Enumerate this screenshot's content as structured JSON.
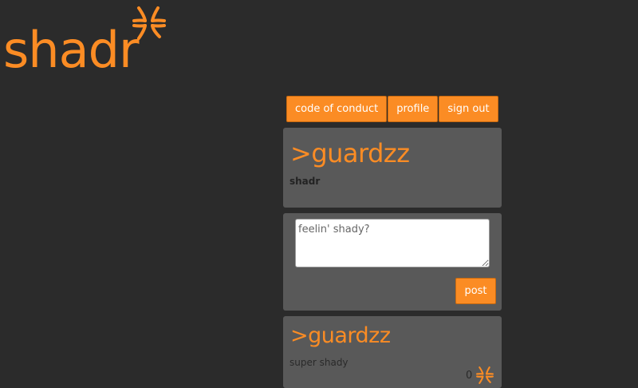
{
  "app": {
    "logo_text": "shadr",
    "brand_color": "#fb8c24",
    "logo_icon": "anger-symbol-icon"
  },
  "nav": {
    "items": [
      {
        "label": "code of conduct"
      },
      {
        "label": "profile"
      },
      {
        "label": "sign out"
      }
    ]
  },
  "profile": {
    "handle": ">guardzz",
    "subtitle": "shadr"
  },
  "compose": {
    "placeholder": "feelin' shady?",
    "value": "",
    "post_label": "post"
  },
  "feed": {
    "posts": [
      {
        "handle": ">guardzz",
        "body": "super shady",
        "shade_count": "0",
        "shade_icon": "anger-symbol-icon"
      }
    ]
  }
}
